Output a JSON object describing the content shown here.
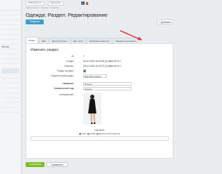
{
  "sidebar": {
    "items": [
      "",
      "",
      "",
      "",
      "",
      "",
      "",
      "",
      "",
      "",
      "",
      "",
      "",
      "",
      "",
      "",
      "",
      "",
      "",
      "",
      ""
    ],
    "highlight_label": "Одежда"
  },
  "topbar": {
    "site_label": "Рабочий стол",
    "settings_label": "Настройки",
    "notif_count": "5"
  },
  "breadcrumb": "Рабочий стол > Каталог > Одежда",
  "page_title": "Одежда: Раздел: Редактирование",
  "actions": {
    "sections_label": "Разделы",
    "add_label": "+ Добавить"
  },
  "tabs": [
    {
      "label": "Раздел",
      "active": true
    },
    {
      "label": "SEO",
      "active": false
    },
    {
      "label": "Дополнительно",
      "active": false
    },
    {
      "label": "Доп. поля",
      "active": false
    },
    {
      "label": "Свойства элементов",
      "active": false
    },
    {
      "label": "Товарные коллекции",
      "active": false
    }
  ],
  "panel_title": "Изменить раздел",
  "fields": {
    "id_label": "ID:",
    "id_value": "7",
    "created_label": "Создан:",
    "created_value": "06.10.2016 16:19:45 [1] admin fb S C",
    "modified_label": "Изменен:",
    "modified_value": "06.12.2016 10:42:27 [1] admin fb S C",
    "active_label": "Раздел активен:",
    "parent_label": "Родительский раздел:",
    "parent_value": "Верхний уровень",
    "name_label": "Название:",
    "name_value": "Платья",
    "code_label": "Символьный код:",
    "code_value": "dresses",
    "image_label": "Изображение:"
  },
  "description": {
    "heading": "Описание",
    "type_text": "Текст",
    "type_html": "HTML",
    "type_visual": "Визуальный редактор"
  },
  "bottom": {
    "save_label": "Сохранить",
    "apply_label": "Применить"
  }
}
